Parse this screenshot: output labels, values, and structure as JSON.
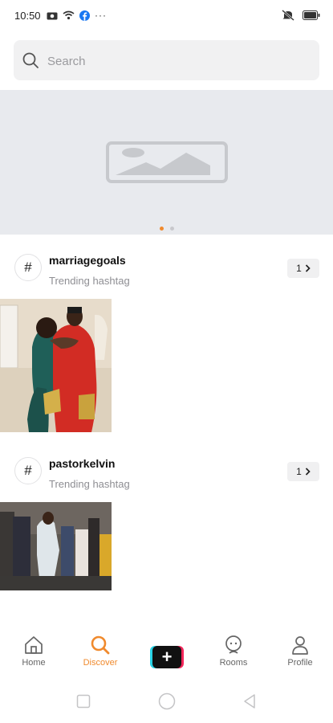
{
  "status_bar": {
    "time": "10:50",
    "more": "···"
  },
  "search": {
    "placeholder": "Search",
    "value": ""
  },
  "banner": {
    "slides": 2,
    "active_slide": 1
  },
  "hashtags": [
    {
      "name": "marriagegoals",
      "subtitle": "Trending hashtag",
      "count": "1"
    },
    {
      "name": "pastorkelvin",
      "subtitle": "Trending hashtag",
      "count": "1"
    }
  ],
  "nav": {
    "home": "Home",
    "discover": "Discover",
    "rooms": "Rooms",
    "profile": "Profile",
    "create_symbol": "+"
  },
  "colors": {
    "accent": "#f08a2d",
    "text": "#111111",
    "muted": "#8e8e93",
    "banner_bg": "#e8eaee"
  }
}
